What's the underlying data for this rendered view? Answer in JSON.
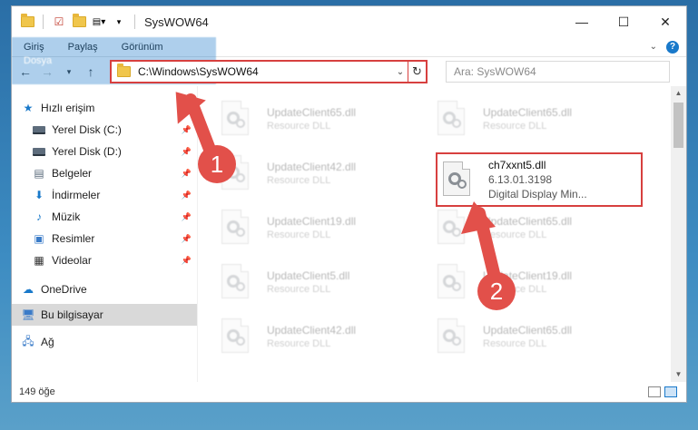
{
  "window": {
    "title": "SysWOW64",
    "controls": {
      "minimize": "—",
      "maximize": "☐",
      "close": "✕"
    }
  },
  "ribbon": {
    "tabs": [
      "Dosya",
      "Giriş",
      "Paylaş",
      "Görünüm"
    ],
    "help": "?"
  },
  "navbar": {
    "address": "C:\\Windows\\SysWOW64",
    "search_placeholder": "Ara: SysWOW64"
  },
  "sidebar": {
    "items": [
      {
        "label": "Hızlı erişim",
        "icon": "star-icon"
      },
      {
        "label": "Yerel Disk (C:)",
        "icon": "disk-icon"
      },
      {
        "label": "Yerel Disk (D:)",
        "icon": "disk-icon"
      },
      {
        "label": "Belgeler",
        "icon": "documents-icon"
      },
      {
        "label": "İndirmeler",
        "icon": "download-icon"
      },
      {
        "label": "Müzik",
        "icon": "music-icon"
      },
      {
        "label": "Resimler",
        "icon": "pictures-icon"
      },
      {
        "label": "Videolar",
        "icon": "video-icon"
      },
      {
        "label": "OneDrive",
        "icon": "cloud-icon"
      },
      {
        "label": "Bu bilgisayar",
        "icon": "computer-icon"
      },
      {
        "label": "Ağ",
        "icon": "network-icon"
      }
    ]
  },
  "files": {
    "left": [
      {
        "name": "UpdateClient65.dll",
        "desc": "Resource DLL"
      },
      {
        "name": "UpdateClient42.dll",
        "desc": "Resource DLL"
      },
      {
        "name": "UpdateClient19.dll",
        "desc": "Resource DLL"
      },
      {
        "name": "UpdateClient5.dll",
        "desc": "Resource DLL"
      },
      {
        "name": "UpdateClient42.dll",
        "desc": "Resource DLL"
      }
    ],
    "right": [
      {
        "name": "UpdateClient65.dll",
        "desc": "Resource DLL"
      },
      {
        "name": "UpdateClient65.dll",
        "desc": "Resource DLL"
      },
      {
        "name": "UpdateClient19.dll",
        "desc": "Resource DLL"
      },
      {
        "name": "UpdateClient65.dll",
        "desc": "Resource DLL"
      }
    ],
    "highlighted": {
      "name": "ch7xxnt5.dll",
      "version": "6.13.01.3198",
      "desc": "Digital Display Min..."
    }
  },
  "status": {
    "count": "149 öğe"
  },
  "callouts": {
    "one": "1",
    "two": "2"
  },
  "colors": {
    "accent": "#1979ca",
    "annotation": "#d7403f"
  }
}
